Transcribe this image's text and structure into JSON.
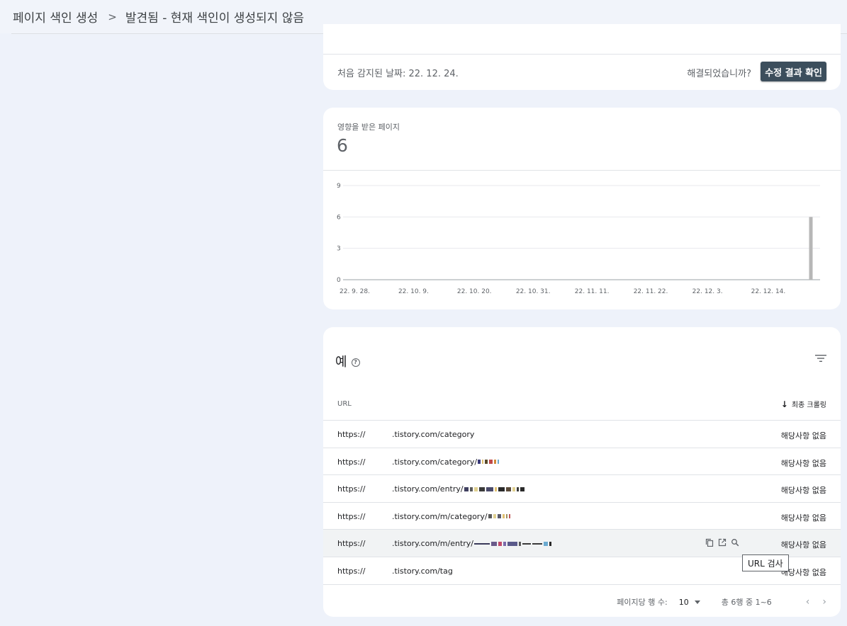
{
  "breadcrumb": {
    "parent": "페이지 색인 생성",
    "current": "발견됨 - 현재 색인이 생성되지 않음"
  },
  "status": {
    "first_detected": "처음 감지된 날짜: 22. 12. 24.",
    "resolved_question": "해결되었습니까?",
    "validate_button": "수정 결과 확인"
  },
  "affected": {
    "label": "영향을 받은 페이지",
    "value": "6"
  },
  "chart_data": {
    "type": "bar",
    "title": "",
    "xlabel": "",
    "ylabel": "",
    "ylim": [
      0,
      9
    ],
    "yticks": [
      "0",
      "3",
      "6",
      "9"
    ],
    "xtick_labels": [
      "22. 9. 28.",
      "22. 10. 9.",
      "22. 10. 20.",
      "22. 10. 31.",
      "22. 11. 11.",
      "22. 11. 22.",
      "22. 12. 3.",
      "22. 12. 14."
    ],
    "x_start": "2022-09-28",
    "x_end": "2022-12-24",
    "points": [
      {
        "date": "2022-12-24",
        "value": 6
      }
    ],
    "bar_color": "#b7b7b7",
    "grid": true
  },
  "examples": {
    "title": "예",
    "col_url": "URL",
    "col_crawl": "최종 크롤링",
    "rows": [
      {
        "proto": "https://",
        "path": ".tistory.com/category",
        "crawl": "해당사항 없음"
      },
      {
        "proto": "https://",
        "path": ".tistory.com/category/",
        "crawl": "해당사항 없음"
      },
      {
        "proto": "https://",
        "path": ".tistory.com/entry/",
        "crawl": "해당사항 없음"
      },
      {
        "proto": "https://",
        "path": ".tistory.com/m/category/",
        "crawl": "해당사항 없음"
      },
      {
        "proto": "https://",
        "path": ".tistory.com/m/entry/",
        "crawl": "해당사항 없음"
      },
      {
        "proto": "https://",
        "path": ".tistory.com/tag",
        "crawl": "해당사항 없음"
      }
    ],
    "tooltip": "URL 검사"
  },
  "pager": {
    "rows_label": "페이지당 행 수:",
    "rows_value": "10",
    "range": "총 6행 중 1~6"
  }
}
